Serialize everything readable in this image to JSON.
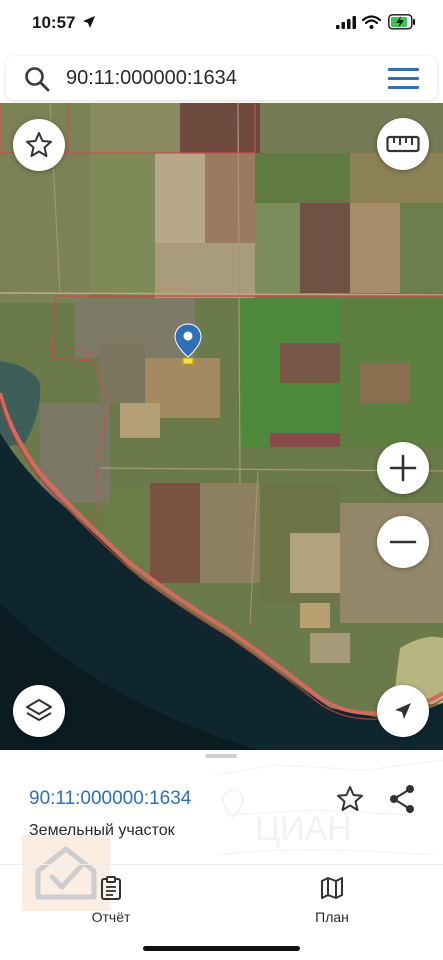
{
  "status_bar": {
    "time": "10:57"
  },
  "search": {
    "query": "90:11:000000:1634"
  },
  "map": {
    "marker": "location-pin-icon",
    "controls": [
      "favorite-star-icon",
      "ruler-icon",
      "zoom-in-icon",
      "zoom-out-icon",
      "layers-icon",
      "navigation-arrow-icon"
    ],
    "colors": {
      "marker": "#2f6fb5",
      "parcel_border": "#c8524b",
      "water": "#0f2a33"
    }
  },
  "details": {
    "cadastral_number": "90:11:000000:1634",
    "property_type": "Земельный участок"
  },
  "tabs": {
    "report_label": "Отчёт",
    "plan_label": "План"
  },
  "accent_color": "#2f6fb5"
}
